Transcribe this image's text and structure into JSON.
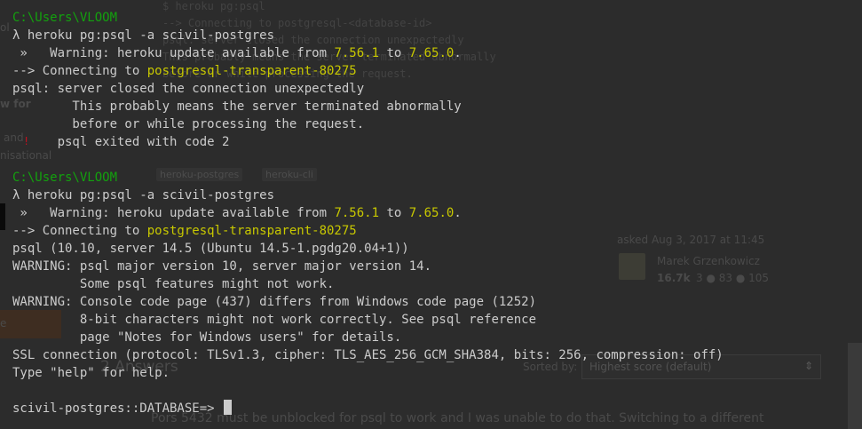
{
  "console": {
    "block1": {
      "path": "C:\\Users\\VLOOM",
      "command": "λ heroku pg:psql -a scivil-postgres",
      "warning_prefix": " »   Warning: heroku update available from ",
      "v_from": "7.56.1",
      "to_word": " to ",
      "v_to": "7.65.0",
      "period": ".",
      "connecting_prefix": "--> Connecting to ",
      "db": "postgresql-transparent-80275",
      "error_lines": [
        "psql: server closed the connection unexpectedly",
        "        This probably means the server terminated abnormally",
        "        before or while processing the request.",
        "      psql exited with code 2"
      ]
    },
    "block2": {
      "path": "C:\\Users\\VLOOM",
      "command": "λ heroku pg:psql -a scivil-postgres",
      "warning_prefix": " »   Warning: heroku update available from ",
      "v_from": "7.56.1",
      "to_word": " to ",
      "v_to": "7.65.0",
      "period": ".",
      "connecting_prefix": "--> Connecting to ",
      "db": "postgresql-transparent-80275",
      "output_lines": [
        "psql (10.10, server 14.5 (Ubuntu 14.5-1.pgdg20.04+1))",
        "WARNING: psql major version 10, server major version 14.",
        "         Some psql features might not work.",
        "WARNING: Console code page (437) differs from Windows code page (1252)",
        "         8-bit characters might not work correctly. See psql reference",
        "         page \"Notes for Windows users\" for details.",
        "SSL connection (protocol: TLSv1.3, cipher: TLS_AES_256_GCM_SHA384, bits: 256, compression: off)",
        "Type \"help\" for help."
      ],
      "prompt": "scivil-postgres::DATABASE=>"
    }
  },
  "background_page": {
    "code_lines": [
      "$ heroku pg:psql",
      "--> Connecting to postgresql-<database-id>",
      "psql: server closed the connection unexpectedly",
      "    This probably means the server terminated abnormally",
      "    before or while processing the request."
    ],
    "tags": [
      "heroku-postgres",
      "heroku-cli"
    ],
    "asked": "asked Aug 3, 2017 at 11:45",
    "user_name": "Marek Grzenkowicz",
    "user_rep": "16.7k",
    "user_badges": "3 ● 83 ● 105",
    "answers_heading": "2 Answers",
    "sorted_by": "Sorted by:",
    "sort_select": "Highest score (default)",
    "answer_snippet": "Pors 5432 must be unblocked for psql to work and I was unable to do that. Switching to a different",
    "side_fragments": [
      "ol",
      "w for",
      "and",
      "nisational",
      "e"
    ]
  }
}
